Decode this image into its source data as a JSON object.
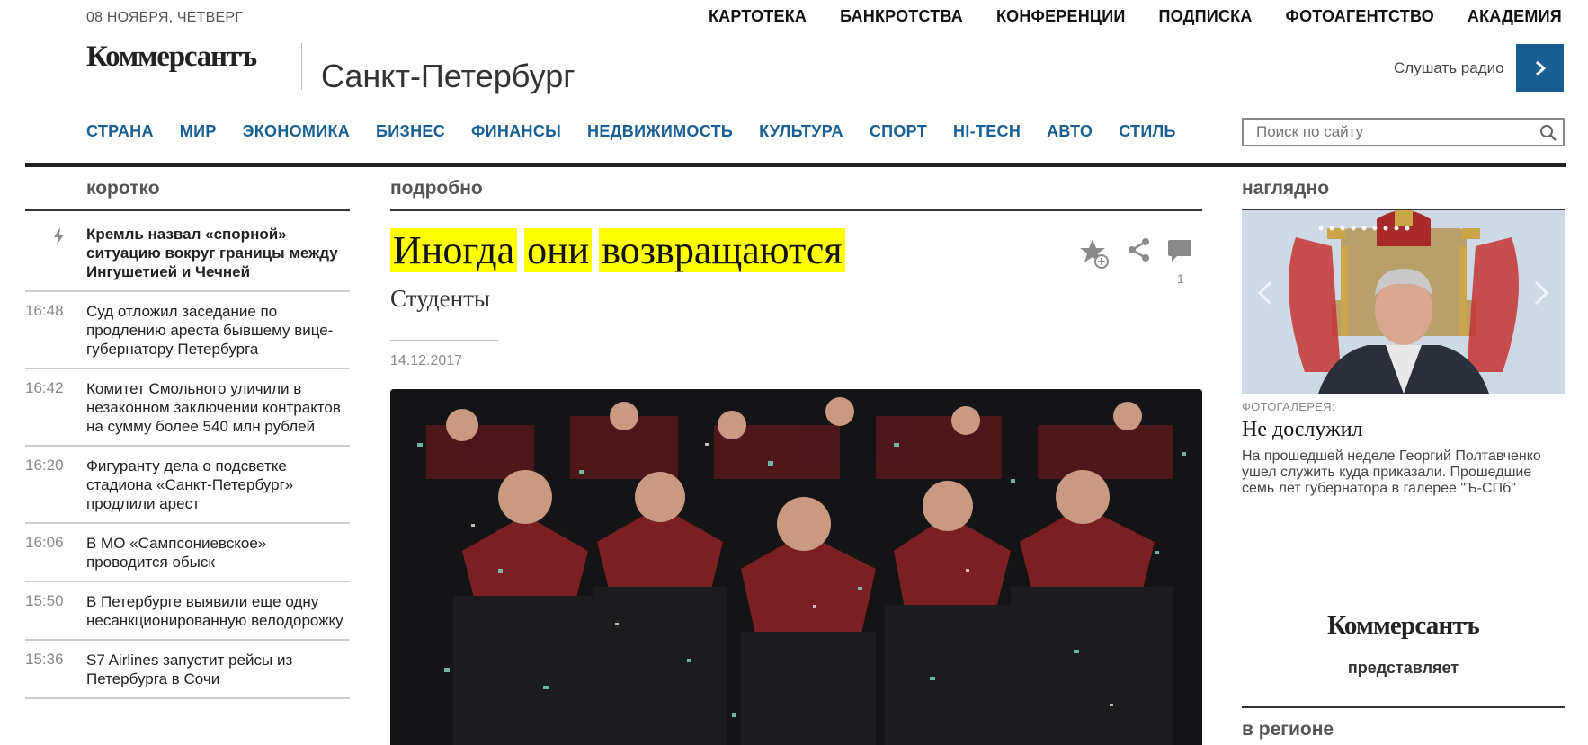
{
  "header": {
    "date": "08 НОЯБРЯ, ЧЕТВЕРГ",
    "top_nav": [
      "КАРТОТЕКА",
      "БАНКРОТСТВА",
      "КОНФЕРЕНЦИИ",
      "ПОДПИСКА",
      "ФОТОАГЕНТСТВО",
      "АКАДЕМИЯ"
    ],
    "logo": "Коммерсантъ",
    "city": "Санкт-Петербург",
    "radio_label": "Слушать радио",
    "main_nav": [
      "СТРАНА",
      "МИР",
      "ЭКОНОМИКА",
      "БИЗНЕС",
      "ФИНАНСЫ",
      "НЕДВИЖИМОСТЬ",
      "КУЛЬТУРА",
      "СПОРТ",
      "HI-TECH",
      "АВТО",
      "СТИЛЬ"
    ],
    "search_placeholder": "Поиск по сайту"
  },
  "sections": {
    "left": "коротко",
    "middle": "подробно",
    "right": "наглядно",
    "region": "в регионе"
  },
  "news": [
    {
      "time": "",
      "title": "Кремль назвал «спорной» ситуацию вокруг границы между Ингушетией и Чечней",
      "lead": true
    },
    {
      "time": "16:48",
      "title": "Суд отложил заседание по продлению ареста бывшему вице-губернатору Петербурга"
    },
    {
      "time": "16:42",
      "title": "Комитет Смольного уличили в незаконном заключении контрактов на сумму более 540 млн рублей"
    },
    {
      "time": "16:20",
      "title": "Фигуранту дела о подсветке стадиона «Санкт-Петербург» продлили арест"
    },
    {
      "time": "16:06",
      "title": "В МО «Сампсониевское» проводится обыск"
    },
    {
      "time": "15:50",
      "title": "В Петербурге выявили еще одну несанкционированную велодорожку"
    },
    {
      "time": "15:36",
      "title": "S7 Airlines запустит рейсы из Петербурга в Сочи"
    }
  ],
  "article": {
    "title_words": [
      "Иногда",
      "они",
      "возвращаются"
    ],
    "subtitle": "Студенты",
    "date": "14.12.2017",
    "comment_count": "1"
  },
  "gallery": {
    "kicker": "ФОТОГАЛЕРЕЯ:",
    "title": "Не дослужил",
    "text": "На прошедшей неделе Георгий Полтавченко ушел служить куда приказали. Прошедшие семь лет губернатора в галерее \"Ъ-СПб\""
  },
  "promo": {
    "logo": "Коммерсантъ",
    "subtitle": "представляет"
  },
  "colors": {
    "brand_blue": "#1a5f94",
    "highlight": "#ffff00",
    "rule": "#222222"
  }
}
